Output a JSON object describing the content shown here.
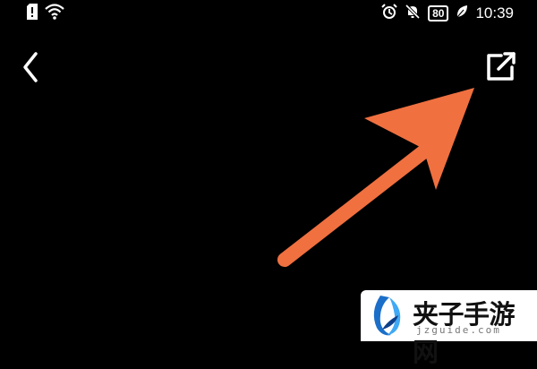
{
  "status_bar": {
    "battery_level": "80",
    "time": "10:39",
    "icons": [
      "sim-alert-icon",
      "wifi-icon",
      "alarm-icon",
      "notifications-off-icon",
      "battery-icon",
      "leaf-icon"
    ]
  },
  "toolbar": {
    "back_icon": "chevron-left-icon",
    "share_icon": "open-external-icon"
  },
  "annotation": {
    "arrow_color": "#f07040"
  },
  "watermark": {
    "brand": "夹子手游网",
    "url": "jzguide.com"
  }
}
